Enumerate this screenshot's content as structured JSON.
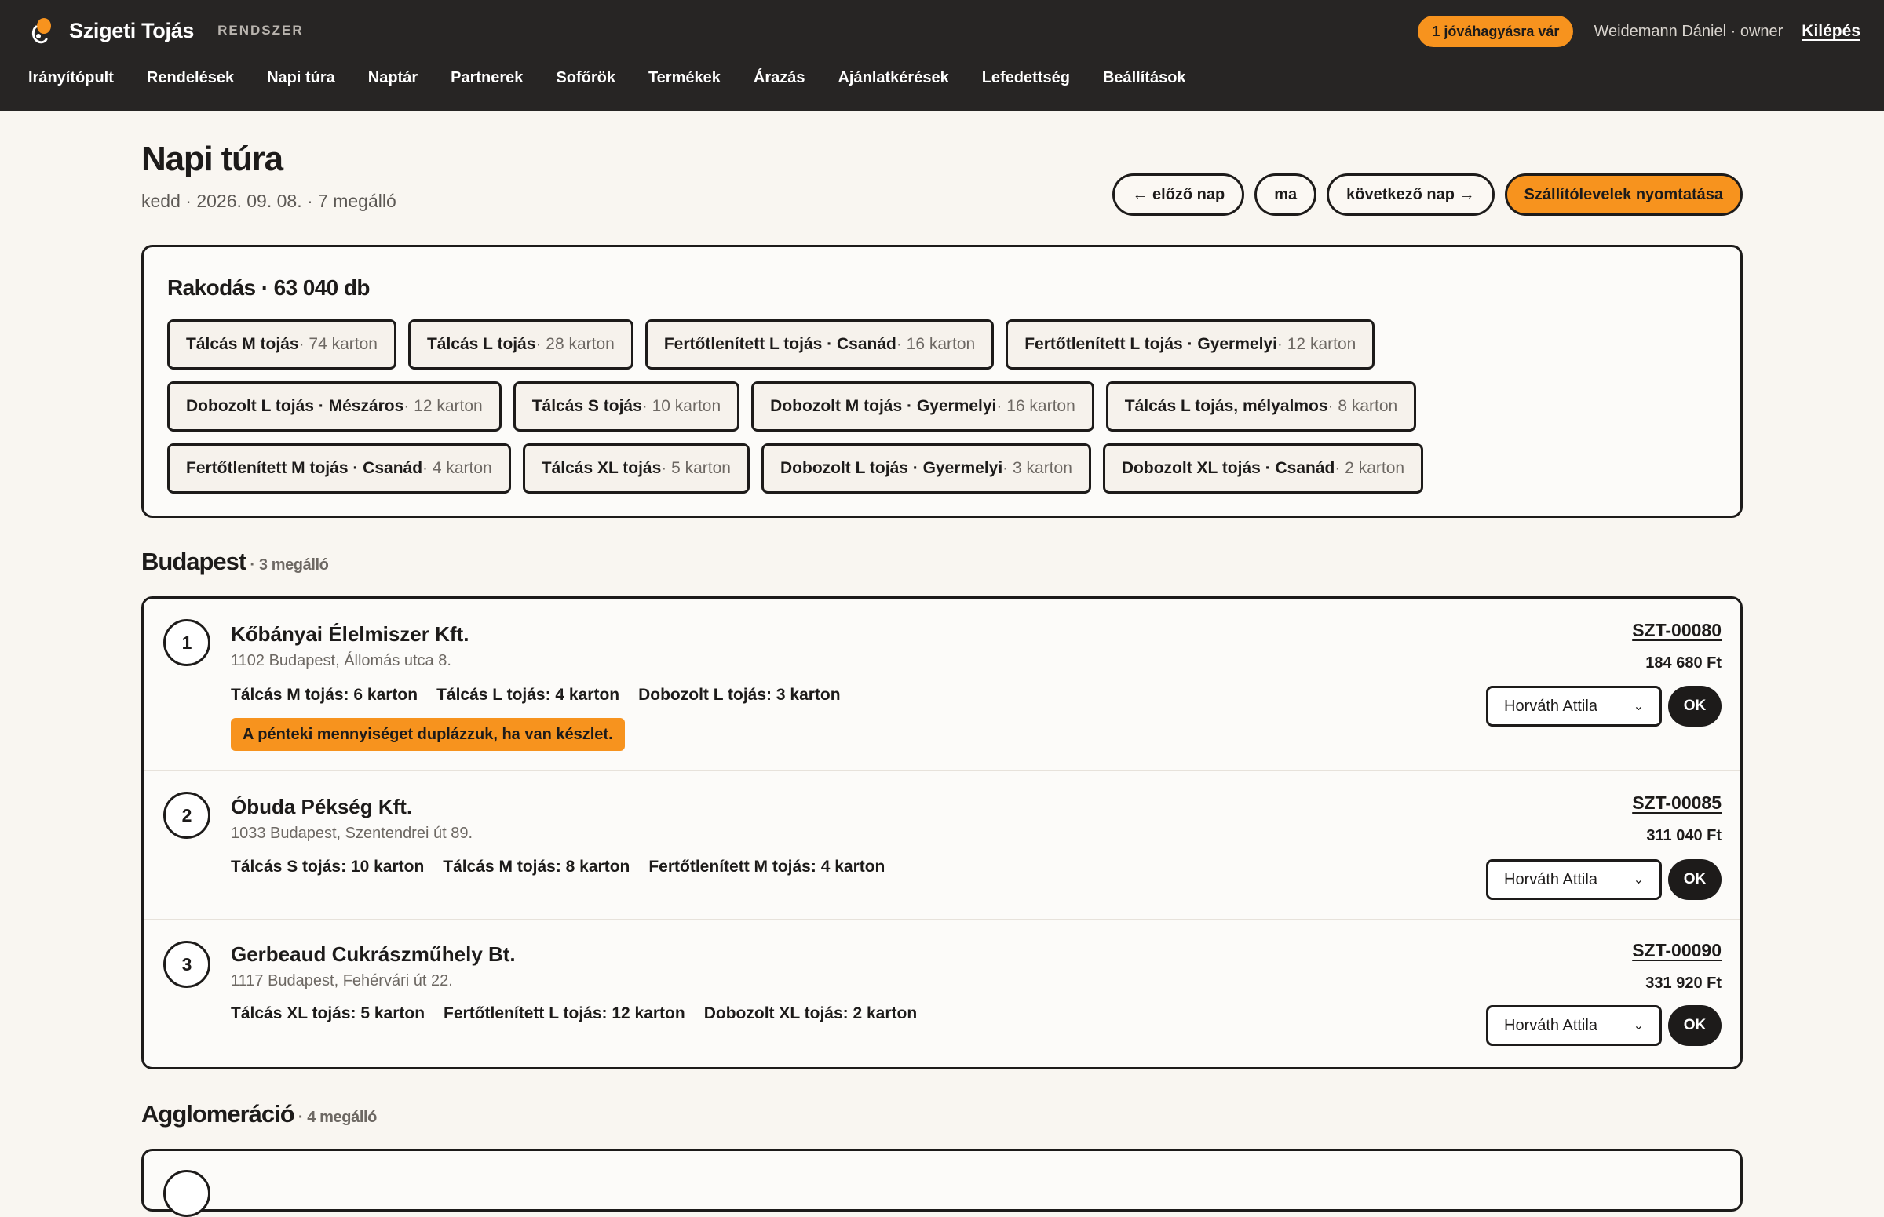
{
  "app": {
    "brand_name": "Szigeti Tojás",
    "brand_tag": "RENDSZER",
    "pending_badge": "1 jóváhagyásra vár",
    "user_label": "Weidemann Dániel · owner",
    "logout_label": "Kilépés",
    "accent_color": "#f7931e",
    "nav": [
      "Irányítópult",
      "Rendelések",
      "Napi túra",
      "Naptár",
      "Partnerek",
      "Sofőrök",
      "Termékek",
      "Árazás",
      "Ajánlatkérések",
      "Lefedettség",
      "Beállítások"
    ]
  },
  "page": {
    "title": "Napi túra",
    "subtitle": "kedd · 2026. 09. 08. · 7 megálló",
    "prev_day": "← előző nap",
    "today": "ma",
    "next_day": "következő nap →",
    "print_button": "Szállítólevelek nyomtatása"
  },
  "loading": {
    "title": "Rakodás · 63 040 db",
    "rows": [
      [
        {
          "name": "Tálcás M tojás",
          "qty": " · 74 karton"
        },
        {
          "name": "Tálcás L tojás",
          "qty": " · 28 karton"
        },
        {
          "name": "Fertőtlenített L tojás · Csanád",
          "qty": " · 16 karton"
        },
        {
          "name": "Fertőtlenített L tojás · Gyermelyi",
          "qty": " · 12 karton"
        }
      ],
      [
        {
          "name": "Dobozolt L tojás · Mészáros",
          "qty": " · 12 karton"
        },
        {
          "name": "Tálcás S tojás",
          "qty": " · 10 karton"
        },
        {
          "name": "Dobozolt M tojás · Gyermelyi",
          "qty": " · 16 karton"
        },
        {
          "name": "Tálcás L tojás, mélyalmos",
          "qty": " · 8 karton"
        }
      ],
      [
        {
          "name": "Fertőtlenített M tojás · Csanád",
          "qty": " · 4 karton"
        },
        {
          "name": "Tálcás XL tojás",
          "qty": " · 5 karton"
        },
        {
          "name": "Dobozolt L tojás · Gyermelyi",
          "qty": " · 3 karton"
        },
        {
          "name": "Dobozolt XL tojás · Csanád",
          "qty": " · 2 karton"
        }
      ]
    ]
  },
  "sections": [
    {
      "name": "Budapest",
      "count": " · 3 megálló",
      "stops": [
        {
          "num": "1",
          "name": "Kőbányai Élelmiszer Kft.",
          "address": "1102 Budapest, Állomás utca 8.",
          "items": [
            "Tálcás M tojás: 6 karton",
            "Tálcás L tojás: 4 karton",
            "Dobozolt L tojás: 3 karton"
          ],
          "note": "A pénteki mennyiséget duplázzuk, ha van készlet.",
          "order_id": "SZT-00080",
          "total": "184 680 Ft",
          "driver": "Horváth Attila",
          "ok": "OK"
        },
        {
          "num": "2",
          "name": "Óbuda Pékség Kft.",
          "address": "1033 Budapest, Szentendrei út 89.",
          "items": [
            "Tálcás S tojás: 10 karton",
            "Tálcás M tojás: 8 karton",
            "Fertőtlenített M tojás: 4 karton"
          ],
          "order_id": "SZT-00085",
          "total": "311 040 Ft",
          "driver": "Horváth Attila",
          "ok": "OK"
        },
        {
          "num": "3",
          "name": "Gerbeaud Cukrászműhely Bt.",
          "address": "1117 Budapest, Fehérvári út 22.",
          "items": [
            "Tálcás XL tojás: 5 karton",
            "Fertőtlenített L tojás: 12 karton",
            "Dobozolt XL tojás: 2 karton"
          ],
          "order_id": "SZT-00090",
          "total": "331 920 Ft",
          "driver": "Horváth Attila",
          "ok": "OK"
        }
      ]
    },
    {
      "name": "Agglomeráció",
      "count": " · 4 megálló"
    }
  ]
}
